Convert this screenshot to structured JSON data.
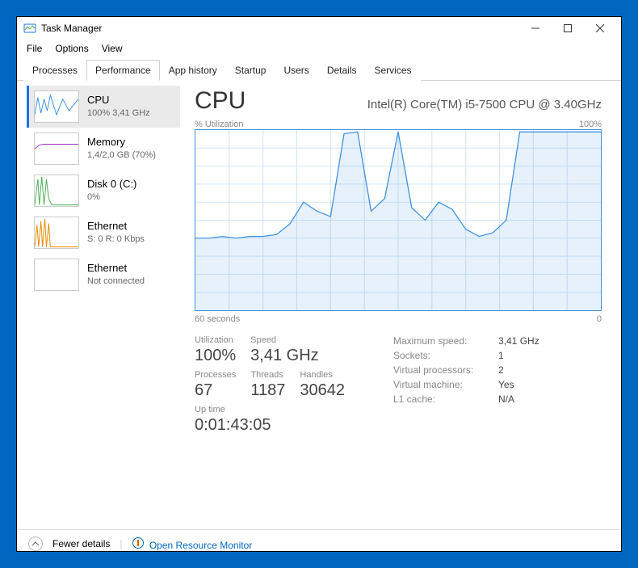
{
  "window": {
    "title": "Task Manager"
  },
  "menu": [
    "File",
    "Options",
    "View"
  ],
  "tabs": [
    "Processes",
    "Performance",
    "App history",
    "Startup",
    "Users",
    "Details",
    "Services"
  ],
  "active_tab": 1,
  "sidebar": [
    {
      "title": "CPU",
      "sub": "100% 3,41 GHz",
      "color": "#3a8fdd"
    },
    {
      "title": "Memory",
      "sub": "1,4/2,0 GB (70%)",
      "color": "#a030c0"
    },
    {
      "title": "Disk 0 (C:)",
      "sub": "0%",
      "color": "#4caf50"
    },
    {
      "title": "Ethernet",
      "sub": "S: 0  R: 0 Kbps",
      "color": "#e68a00"
    },
    {
      "title": "Ethernet",
      "sub": "Not connected",
      "color": "#d0d0d0"
    }
  ],
  "main": {
    "title": "CPU",
    "cpu_name": "Intel(R) Core(TM) i5-7500 CPU @ 3.40GHz",
    "graph_top_left": "% Utilization",
    "graph_top_right": "100%",
    "graph_bottom_left": "60 seconds",
    "graph_bottom_right": "0"
  },
  "stats": {
    "utilization": {
      "label": "Utilization",
      "value": "100%"
    },
    "speed": {
      "label": "Speed",
      "value": "3,41 GHz"
    },
    "processes": {
      "label": "Processes",
      "value": "67"
    },
    "threads": {
      "label": "Threads",
      "value": "1187"
    },
    "handles": {
      "label": "Handles",
      "value": "30642"
    },
    "uptime": {
      "label": "Up time",
      "value": "0:01:43:05"
    }
  },
  "right_stats": [
    {
      "k": "Maximum speed:",
      "v": "3,41 GHz"
    },
    {
      "k": "Sockets:",
      "v": "1"
    },
    {
      "k": "Virtual processors:",
      "v": "2"
    },
    {
      "k": "Virtual machine:",
      "v": "Yes"
    },
    {
      "k": "L1 cache:",
      "v": "N/A"
    }
  ],
  "footer": {
    "fewer": "Fewer details",
    "resmon": "Open Resource Monitor"
  },
  "chart_data": {
    "type": "line",
    "title": "% Utilization",
    "xlabel": "seconds",
    "ylabel": "% Utilization",
    "xlim": [
      60,
      0
    ],
    "ylim": [
      0,
      100
    ],
    "x": [
      60,
      58,
      56,
      54,
      52,
      50,
      48,
      46,
      44,
      42,
      40,
      38,
      36,
      34,
      32,
      30,
      28,
      26,
      24,
      22,
      20,
      18,
      16,
      14,
      12,
      10,
      8,
      6,
      4,
      2,
      0
    ],
    "values": [
      40,
      40,
      41,
      40,
      41,
      41,
      42,
      48,
      60,
      55,
      52,
      98,
      99,
      55,
      62,
      99,
      57,
      50,
      60,
      56,
      45,
      41,
      43,
      50,
      99,
      99,
      99,
      99,
      99,
      99,
      99
    ]
  }
}
